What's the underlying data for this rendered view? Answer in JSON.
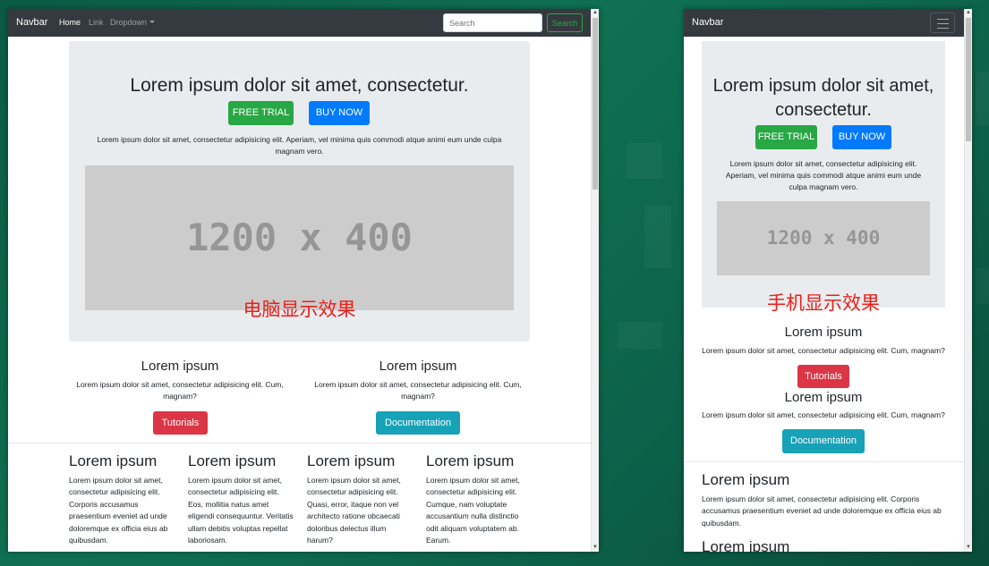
{
  "desktop": {
    "navbar": {
      "brand": "Navbar",
      "links": [
        "Home",
        "Link",
        "Dropdown"
      ],
      "search_placeholder": "Search",
      "search_button": "Search"
    },
    "hero": {
      "title": "Lorem ipsum dolor sit amet, consectetur.",
      "btn_trial": "FREE TRIAL",
      "btn_buy": "BUY NOW",
      "lead": "Lorem ipsum dolor sit amet, consectetur adipisicing elit. Aperiam, vel minima quis commodi atque animi eum unde culpa magnam vero.",
      "image_text": "1200 x 400",
      "label": "电脑显示效果"
    },
    "features": [
      {
        "title": "Lorem ipsum",
        "text": "Lorem ipsum dolor sit amet, consectetur adipisicing elit. Cum, magnam?",
        "button": "Tutorials"
      },
      {
        "title": "Lorem ipsum",
        "text": "Lorem ipsum dolor sit amet, consectetur adipisicing elit. Cum, magnam?",
        "button": "Documentation"
      }
    ],
    "columns": [
      {
        "title": "Lorem ipsum",
        "text": "Lorem ipsum dolor sit amet, consectetur adipisicing elit. Corporis accusamus praesentium eveniet ad unde doloremque ex officia eius ab quibusdam."
      },
      {
        "title": "Lorem ipsum",
        "text": "Lorem ipsum dolor sit amet, consectetur adipisicing elit. Eos, mollitia natus amet eligendi consequuntur. Veritatis ullam debitis voluptas repellat laboriosam."
      },
      {
        "title": "Lorem ipsum",
        "text": "Lorem ipsum dolor sit amet, consectetur adipisicing elit. Quasi, error, itaque non vel architecto ratione obcaecati doloribus delectus illum harum?"
      },
      {
        "title": "Lorem ipsum",
        "text": "Lorem ipsum dolor sit amet, consectetur adipisicing elit. Cumque, nam voluptate accusantium nulla distinctio odit aliquam voluptatem ab. Earum."
      }
    ]
  },
  "mobile": {
    "navbar": {
      "brand": "Navbar"
    },
    "hero": {
      "title": "Lorem ipsum dolor sit amet, consectetur.",
      "btn_trial": "FREE TRIAL",
      "btn_buy": "BUY NOW",
      "lead": "Lorem ipsum dolor sit amet, consectetur adipisicing elit. Aperiam, vel minima quis commodi atque animi eum unde culpa magnam vero.",
      "image_text": "1200 x 400",
      "label": "手机显示效果"
    },
    "features": [
      {
        "title": "Lorem ipsum",
        "text": "Lorem ipsum dolor sit amet, consectetur adipisicing elit. Cum, magnam?",
        "button": "Tutorials"
      },
      {
        "title": "Lorem ipsum",
        "text": "Lorem ipsum dolor sit amet, consectetur adipisicing elit. Cum, magnam?",
        "button": "Documentation"
      }
    ],
    "columns": [
      {
        "title": "Lorem ipsum",
        "text": "Lorem ipsum dolor sit amet, consectetur adipisicing elit. Corporis accusamus praesentium eveniet ad unde doloremque ex officia eius ab quibusdam."
      },
      {
        "title": "Lorem ipsum",
        "text": ""
      }
    ]
  },
  "colors": {
    "navbar": "#343a40",
    "jumbotron": "#e9ecef",
    "success": "#28a745",
    "primary": "#007bff",
    "danger": "#dc3545",
    "info": "#17a2b8",
    "label_red": "#e8211a"
  },
  "icons": {
    "dropdown": "caret-down-icon",
    "menu": "hamburger-menu-icon"
  }
}
